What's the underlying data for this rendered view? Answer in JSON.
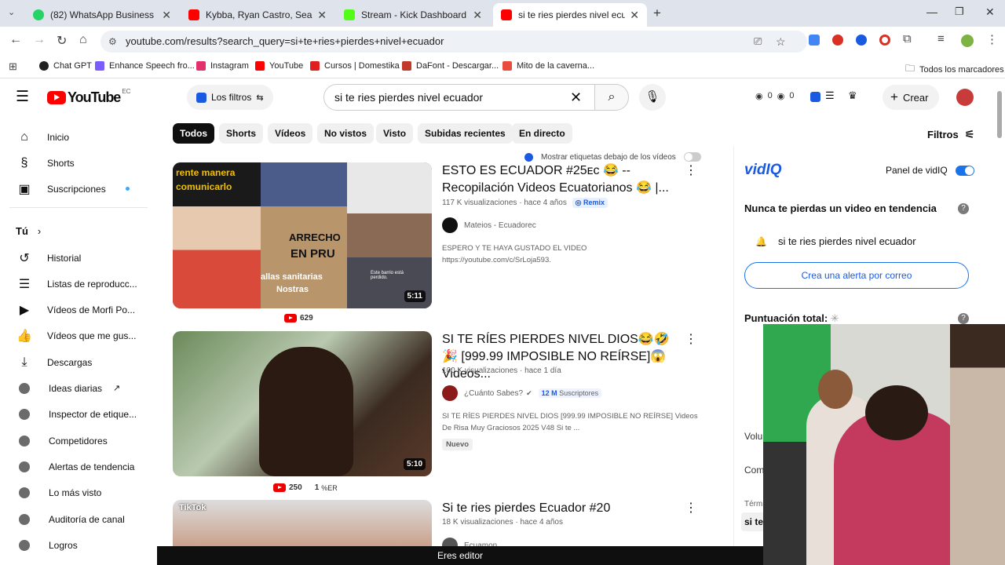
{
  "browser": {
    "tabs": [
      {
        "title": "(82) WhatsApp Business",
        "color": "#25D366"
      },
      {
        "title": "Kybba, Ryan Castro, Sean Paul &",
        "color": "#FF0000"
      },
      {
        "title": "Stream - Kick Dashboard",
        "color": "#53FC18"
      },
      {
        "title": "si te ries pierdes nivel ecuador",
        "color": "#FF0000"
      }
    ],
    "url": "youtube.com/results?search_query=si+te+ries+pierdes+nivel+ecuador",
    "bookmarks": [
      {
        "label": "Chat GPT",
        "color": "#222222"
      },
      {
        "label": "Enhance Speech fro...",
        "color": "#7a5cff"
      },
      {
        "label": "Instagram",
        "color": "#e1306c"
      },
      {
        "label": "YouTube",
        "color": "#ff0000"
      },
      {
        "label": "Cursos | Domestika",
        "color": "#e02020"
      },
      {
        "label": "DaFont - Descargar...",
        "color": "#c0392b"
      },
      {
        "label": "Mito de la caverna...",
        "color": "#e74c3c"
      }
    ],
    "all_bookmarks": "Todos los marcadores"
  },
  "youtube": {
    "logo": "YouTube",
    "country": "EC",
    "filters_label": "Los filtros",
    "search_value": "si te ries pierdes nivel ecuador",
    "stats": [
      "0",
      "0"
    ],
    "create_label": "Crear",
    "sidebar": {
      "main": [
        {
          "label": "Inicio",
          "icon": "home-icon",
          "glyph": "⌂"
        },
        {
          "label": "Shorts",
          "icon": "shorts-icon",
          "glyph": "§"
        },
        {
          "label": "Suscripciones",
          "icon": "subscriptions-icon",
          "glyph": "▣"
        }
      ],
      "you_label": "Tú",
      "you": [
        {
          "label": "Historial",
          "icon": "history-icon",
          "glyph": "↺"
        },
        {
          "label": "Listas de reproducc...",
          "icon": "playlist-icon",
          "glyph": "☰"
        },
        {
          "label": "Vídeos de Morfi Po...",
          "icon": "play-square-icon",
          "glyph": "▶"
        },
        {
          "label": "Vídeos que me gus...",
          "icon": "thumbs-up-icon",
          "glyph": "👍"
        },
        {
          "label": "Descargas",
          "icon": "download-icon",
          "glyph": "⤓"
        }
      ],
      "vidiq": [
        "Ideas diarias",
        "Inspector de etique...",
        "Competidores",
        "Alertas de tendencia",
        "Lo más visto",
        "Auditoría de canal",
        "Logros"
      ]
    },
    "chips": [
      "Todos",
      "Shorts",
      "Vídeos",
      "No vistos",
      "Visto",
      "Subidas recientes",
      "En directo"
    ],
    "filters_right": "Filtros",
    "show_tags_label": "Mostrar etiquetas debajo de los vídeos",
    "videos": [
      {
        "title": "ESTO ES ECUADOR #25ᴇᴄ 😂 -- Recopilación Videos Ecuatorianos 😂 |...",
        "views": "117 K visualizaciones",
        "age": "hace 4 años",
        "badge": "Remix",
        "channel": "Mateios - Ecuadorec",
        "desc": "ESPERO Y TE HAYA GUSTADO EL VIDEO\nhttps://youtube.com/c/SrLoja593.",
        "duration": "5:11",
        "under_count": "629",
        "thumb_texts": [
          "rente manera",
          "comunicarlo",
          "ARRECHO",
          "EN PRU",
          "allas sanitarias",
          "Nostras",
          "Este barrio está perdido."
        ]
      },
      {
        "title": "SI TE RÍES PIERDES NIVEL DIOS😂🤣🎉 [999.99 IMPOSIBLE NO REÍRSE]😱 Videos...",
        "views": "100 K visualizaciones",
        "age": "hace 1 día",
        "channel": "¿Cuánto Sabes?",
        "subs_value": "12 M",
        "subs_label": "Suscriptores",
        "desc": "SI TE RÍES PIERDES NIVEL DIOS [999.99 IMPOSIBLE NO REÍRSE] Videos De Risa Muy Graciosos 2025 V48 Si te ...",
        "new_badge": "Nuevo",
        "duration": "5:10",
        "under_count": "250",
        "under_extra": "1",
        "under_extra_label": "%ER"
      },
      {
        "title": "Si te ries pierdes Ecuador #20",
        "views": "18 K visualizaciones",
        "age": "hace 4 años",
        "channel": "Ecuamon",
        "thumb_text": "TikTok"
      }
    ]
  },
  "vidiq": {
    "logo": "vidIQ",
    "panel_label": "Panel de vidIQ",
    "trend_title": "Nunca te pierdas un video en tendencia",
    "trend_item": "si te ries pierdes nivel ecuador",
    "alert_button": "Crea una alerta por correo",
    "score_label": "Puntuación total:",
    "partial": [
      "Volu",
      "Com",
      "Térm",
      "si te"
    ]
  },
  "editor_bar": "Eres editor"
}
